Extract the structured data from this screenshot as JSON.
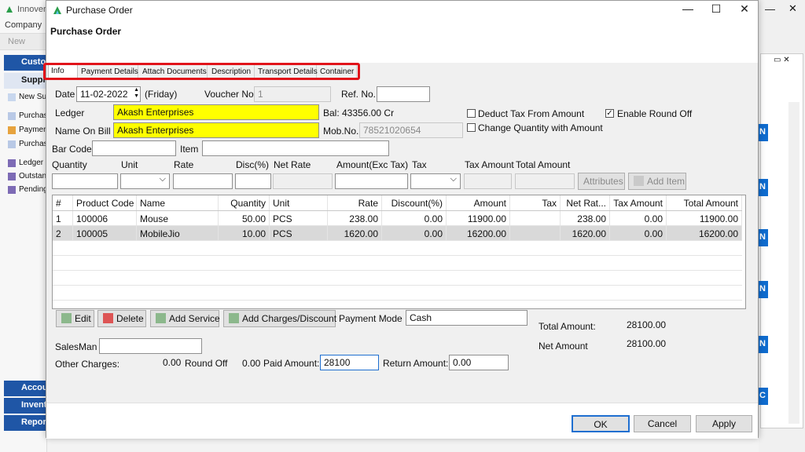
{
  "background_app": {
    "title": "Innoven",
    "menu": "Company",
    "new_label": "New",
    "sections": [
      "Custo",
      "Suppl",
      "Accou",
      "Invent",
      "Report"
    ],
    "items": [
      "New Sup",
      "Purchas",
      "Paymen",
      "Purchas",
      "Ledger R",
      "Outstan",
      "Pending"
    ],
    "right_button_letters": [
      "N",
      "N",
      "N",
      "N",
      "N",
      "C"
    ]
  },
  "window": {
    "title": "Purchase Order",
    "header_title": "Purchase Order"
  },
  "tabs": [
    {
      "label": "Info",
      "active": true
    },
    {
      "label": "Payment Details"
    },
    {
      "label": "Attach Documents"
    },
    {
      "label": "Description"
    },
    {
      "label": "Transport Details"
    },
    {
      "label": "Container"
    }
  ],
  "form": {
    "date_label": "Date",
    "date_value": "11-02-2022",
    "day_label": "(Friday)",
    "voucher_label": "Voucher No",
    "voucher_value": "1",
    "ref_label": "Ref. No.",
    "ref_value": "",
    "ledger_label": "Ledger",
    "ledger_value": "Akash Enterprises",
    "bal_label": "Bal: 43356.00 Cr",
    "name_on_bill_label": "Name On Bill",
    "name_on_bill_value": "Akash Enterprises",
    "mob_label": "Mob.No.",
    "mob_value": "78521020654",
    "deduct_tax_label": "Deduct Tax From Amount",
    "change_qty_label": "Change Quantity with Amount",
    "enable_round_off_label": "Enable Round Off",
    "barcode_label": "Bar Code",
    "item_label": "Item"
  },
  "entry_row": {
    "headers": [
      "Quantity",
      "Unit",
      "Rate",
      "Disc(%)",
      "Net Rate",
      "Amount(Exc Tax)",
      "Tax",
      "Tax Amount",
      "Total Amount"
    ],
    "attributes_label": "Attributes",
    "add_item_label": "Add Item"
  },
  "grid": {
    "headers": [
      "#",
      "Product Code",
      "Name",
      "Quantity",
      "Unit",
      "Rate",
      "Discount(%)",
      "Amount",
      "Tax",
      "Net Rat...",
      "Tax Amount",
      "Total Amount"
    ],
    "rows": [
      [
        "1",
        "100006",
        "Mouse",
        "50.00",
        "PCS",
        "238.00",
        "0.00",
        "11900.00",
        "",
        "238.00",
        "0.00",
        "11900.00"
      ],
      [
        "2",
        "100005",
        "MobileJio",
        "10.00",
        "PCS",
        "1620.00",
        "0.00",
        "16200.00",
        "",
        "1620.00",
        "0.00",
        "16200.00"
      ]
    ]
  },
  "actions": {
    "edit_label": "Edit",
    "delete_label": "Delete",
    "add_service_label": "Add Service",
    "add_charges_label": "Add Charges/Discount",
    "payment_mode_label": "Payment Mode",
    "payment_mode_value": "Cash"
  },
  "totals": {
    "total_amount_label": "Total Amount:",
    "total_amount_value": "28100.00",
    "net_amount_label": "Net Amount",
    "net_amount_value": "28100.00"
  },
  "bottom": {
    "salesman_label": "SalesMan",
    "salesman_value": "",
    "other_charges_label": "Other Charges:",
    "other_charges_value": "0.00",
    "round_off_label": "Round Off",
    "round_off_value": "0.00",
    "paid_amount_label": "Paid Amount:",
    "paid_amount_value": "28100",
    "return_amount_label": "Return Amount:",
    "return_amount_value": "0.00"
  },
  "footer": {
    "ok_label": "OK",
    "cancel_label": "Cancel",
    "apply_label": "Apply"
  },
  "colors": {
    "highlight_yellow": "#ffff00",
    "annotation_red": "#e1131a",
    "nav_blue": "#1f56a6"
  }
}
